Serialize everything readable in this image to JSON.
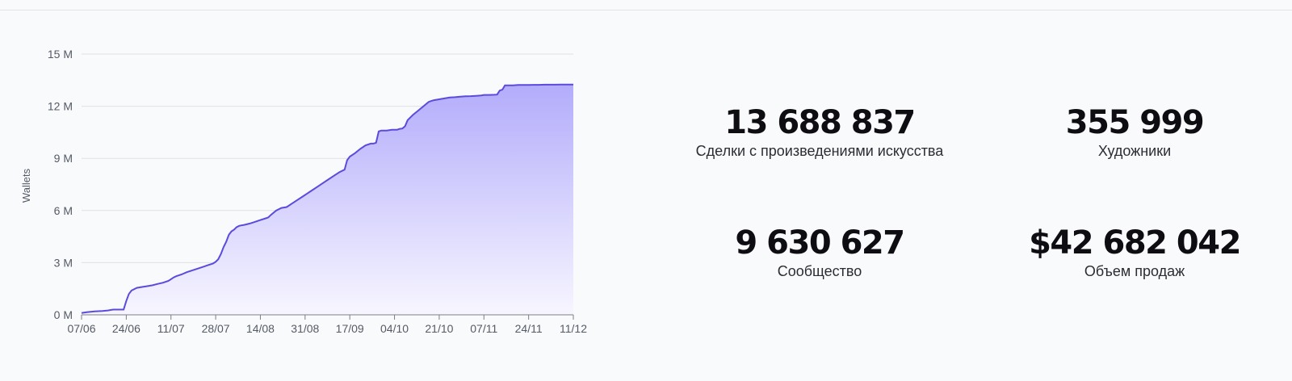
{
  "chart_data": {
    "type": "area",
    "ylabel": "Wallets",
    "xlabel": "",
    "title": "",
    "ylim": [
      0,
      15
    ],
    "y_ticks": [
      0,
      3,
      6,
      9,
      12,
      15
    ],
    "y_tick_labels": [
      "0 M",
      "3 M",
      "6 M",
      "9 M",
      "12 M",
      "15 M"
    ],
    "x_tick_labels": [
      "07/06",
      "24/06",
      "11/07",
      "28/07",
      "14/08",
      "31/08",
      "17/09",
      "04/10",
      "21/10",
      "07/11",
      "24/11",
      "11/12"
    ],
    "x_tick_days": [
      0,
      17,
      34,
      51,
      68,
      85,
      102,
      119,
      136,
      153,
      170,
      187
    ],
    "xlim": [
      0,
      187
    ],
    "grid": "horizontal",
    "series": [
      {
        "x_days": [
          0,
          2,
          5,
          8,
          10,
          12,
          14,
          16,
          17,
          18,
          19,
          21,
          23,
          25,
          27,
          29,
          31,
          33,
          34,
          35,
          36,
          38,
          40,
          42,
          44,
          46,
          48,
          50,
          51,
          52,
          53,
          54,
          55,
          56,
          57,
          58,
          59,
          60,
          62,
          64,
          66,
          68,
          70,
          71,
          72,
          74,
          76,
          78,
          80,
          82,
          84,
          86,
          88,
          90,
          92,
          94,
          96,
          98,
          100,
          101,
          102,
          104,
          106,
          108,
          110,
          111,
          112,
          113,
          114,
          116,
          118,
          120,
          121,
          122,
          123,
          124,
          126,
          128,
          130,
          132,
          133,
          134,
          136,
          138,
          140,
          142,
          144,
          146,
          148,
          150,
          152,
          153,
          155,
          157,
          158,
          159,
          160,
          161,
          162,
          164,
          166,
          168,
          170,
          172,
          174,
          176,
          178,
          180,
          182,
          184,
          186,
          187
        ],
        "y_millions": [
          0.1,
          0.15,
          0.2,
          0.22,
          0.25,
          0.3,
          0.3,
          0.3,
          0.8,
          1.2,
          1.4,
          1.55,
          1.6,
          1.65,
          1.7,
          1.78,
          1.85,
          1.95,
          2.05,
          2.15,
          2.22,
          2.32,
          2.45,
          2.55,
          2.65,
          2.75,
          2.85,
          2.95,
          3.05,
          3.2,
          3.5,
          3.9,
          4.2,
          4.6,
          4.8,
          4.9,
          5.05,
          5.12,
          5.18,
          5.25,
          5.35,
          5.45,
          5.55,
          5.6,
          5.75,
          6.0,
          6.15,
          6.2,
          6.4,
          6.6,
          6.8,
          7.0,
          7.2,
          7.4,
          7.6,
          7.8,
          8.0,
          8.2,
          8.35,
          8.9,
          9.1,
          9.3,
          9.55,
          9.75,
          9.85,
          9.85,
          9.9,
          10.55,
          10.6,
          10.6,
          10.65,
          10.65,
          10.7,
          10.72,
          10.85,
          11.2,
          11.5,
          11.75,
          12.0,
          12.25,
          12.3,
          12.35,
          12.4,
          12.45,
          12.5,
          12.52,
          12.55,
          12.57,
          12.58,
          12.6,
          12.62,
          12.65,
          12.65,
          12.66,
          12.67,
          12.9,
          12.95,
          13.2,
          13.2,
          13.2,
          13.22,
          13.22,
          13.22,
          13.23,
          13.23,
          13.24,
          13.24,
          13.24,
          13.25,
          13.25,
          13.25,
          13.25
        ]
      }
    ],
    "colors": {
      "line": "#5b4bdc",
      "fill_top": "#b3acfb",
      "fill_bottom": "#f7f6ff",
      "grid": "#dfe0e6",
      "axis": "#7a7e8a"
    }
  },
  "stats": {
    "art_deals": {
      "value": "13 688 837",
      "label": "Сделки с произведениями искусства"
    },
    "artists": {
      "value": "355 999",
      "label": "Художники"
    },
    "community": {
      "value": "9 630 627",
      "label": "Сообщество"
    },
    "sales_volume": {
      "value": "$42 682 042",
      "label": "Объем продаж"
    }
  }
}
